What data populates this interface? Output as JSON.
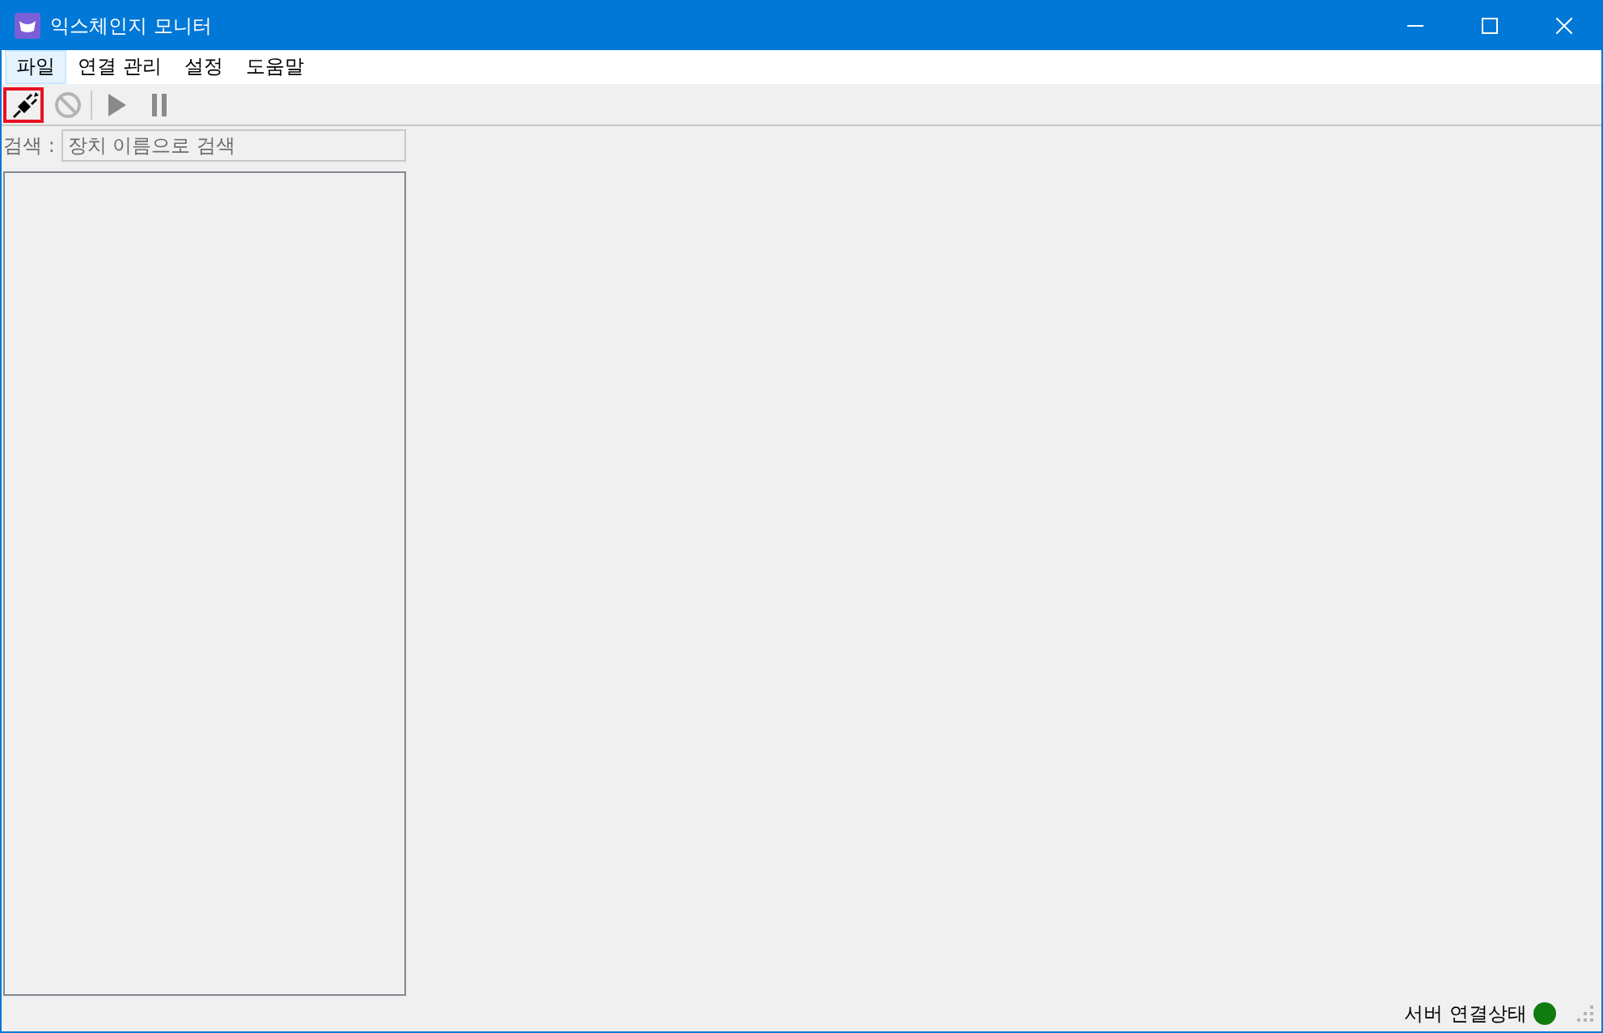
{
  "window": {
    "title": "익스체인지 모니터"
  },
  "menu": [
    {
      "label": "파일",
      "selected": true
    },
    {
      "label": "연결 관리",
      "selected": false
    },
    {
      "label": "설정",
      "selected": false
    },
    {
      "label": "도움말",
      "selected": false
    }
  ],
  "toolbar": [
    {
      "kind": "connect",
      "selected": true,
      "disabled": false
    },
    {
      "kind": "stop",
      "selected": false,
      "disabled": true
    },
    {
      "kind": "play",
      "selected": false,
      "disabled": true
    },
    {
      "kind": "pause",
      "selected": false,
      "disabled": true
    }
  ],
  "search": {
    "label": "검색 :",
    "placeholder": "장치 이름으로 검색"
  },
  "status_bar": {
    "label": "서버 연결상태",
    "color": "#107c10"
  }
}
